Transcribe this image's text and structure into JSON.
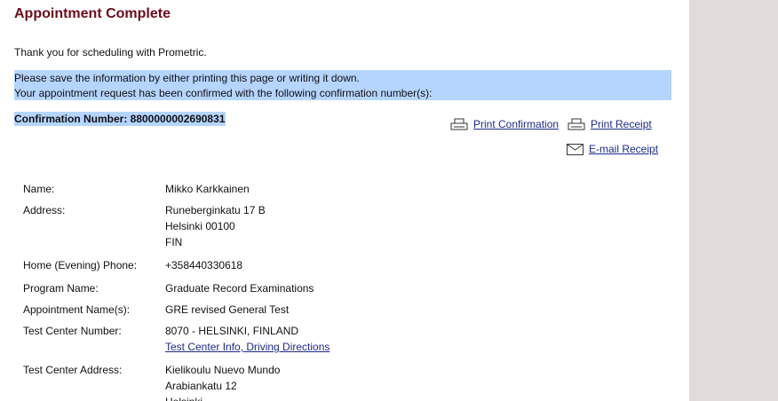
{
  "header": {
    "title": "Appointment Complete"
  },
  "intro": {
    "thanks": "Thank you for scheduling with Prometric.",
    "save_notice": "Please save the information by either printing this page or writing it down.",
    "confirmed_notice": "Your appointment request has been confirmed with the following confirmation number(s):",
    "confirmation": "Confirmation Number: 8800000002690831"
  },
  "actions": {
    "print_confirmation": "Print Confirmation",
    "print_receipt": "Print Receipt",
    "email_receipt": "E-mail Receipt"
  },
  "details": {
    "name": {
      "label": "Name:",
      "value": "Mikko Karkkainen"
    },
    "address": {
      "label": "Address:",
      "lines": [
        "Runeberginkatu 17 B",
        "Helsinki 00100",
        "FIN"
      ]
    },
    "phone": {
      "label": "Home (Evening) Phone:",
      "value": "+358440330618"
    },
    "program": {
      "label": "Program Name:",
      "value": "Graduate Record Examinations"
    },
    "appointment": {
      "label": "Appointment Name(s):",
      "value": "GRE revised General Test"
    },
    "center_number": {
      "label": "Test Center Number:",
      "value": "8070 - HELSINKI, FINLAND",
      "link": "Test Center Info, Driving Directions"
    },
    "center_address": {
      "label": "Test Center Address:",
      "lines": [
        "Kielikoulu Nuevo Mundo",
        "Arabiankatu 12",
        "Helsinki"
      ]
    }
  },
  "colors": {
    "title": "#6d0c1c",
    "link": "#1b2a8a",
    "highlight": "#b5d5ff",
    "side_panel": "#e1dcdb"
  }
}
